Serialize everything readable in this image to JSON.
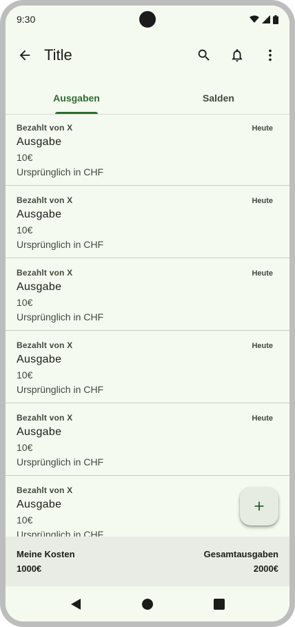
{
  "status_bar": {
    "time": "9:30"
  },
  "app_bar": {
    "title": "Title",
    "back_icon": "arrow-back-icon",
    "actions": [
      "search-icon",
      "bell-icon",
      "more-vert-icon"
    ]
  },
  "tabs": [
    {
      "label": "Ausgaben",
      "active": true
    },
    {
      "label": "Salden",
      "active": false
    }
  ],
  "expenses": [
    {
      "payer": "Bezahlt von X",
      "date": "Heute",
      "title": "Ausgabe",
      "amount": "10€",
      "original": "Ursprünglich in CHF"
    },
    {
      "payer": "Bezahlt von X",
      "date": "Heute",
      "title": "Ausgabe",
      "amount": "10€",
      "original": "Ursprünglich in CHF"
    },
    {
      "payer": "Bezahlt von X",
      "date": "Heute",
      "title": "Ausgabe",
      "amount": "10€",
      "original": "Ursprünglich in CHF"
    },
    {
      "payer": "Bezahlt von X",
      "date": "Heute",
      "title": "Ausgabe",
      "amount": "10€",
      "original": "Ursprünglich in CHF"
    },
    {
      "payer": "Bezahlt von X",
      "date": "Heute",
      "title": "Ausgabe",
      "amount": "10€",
      "original": "Ursprünglich in CHF"
    },
    {
      "payer": "Bezahlt von X",
      "date": "",
      "title": "Ausgabe",
      "amount": "10€",
      "original": "Ursprünglich in CHF"
    }
  ],
  "fab": {
    "icon": "add-icon"
  },
  "summary": {
    "my_costs_label": "Meine Kosten",
    "my_costs_value": "1000€",
    "total_label": "Gesamtausgaben",
    "total_value": "2000€"
  },
  "colors": {
    "accent": "#2e6b2f",
    "surface": "#f4faf0",
    "summary_bg": "#e8ece4"
  }
}
